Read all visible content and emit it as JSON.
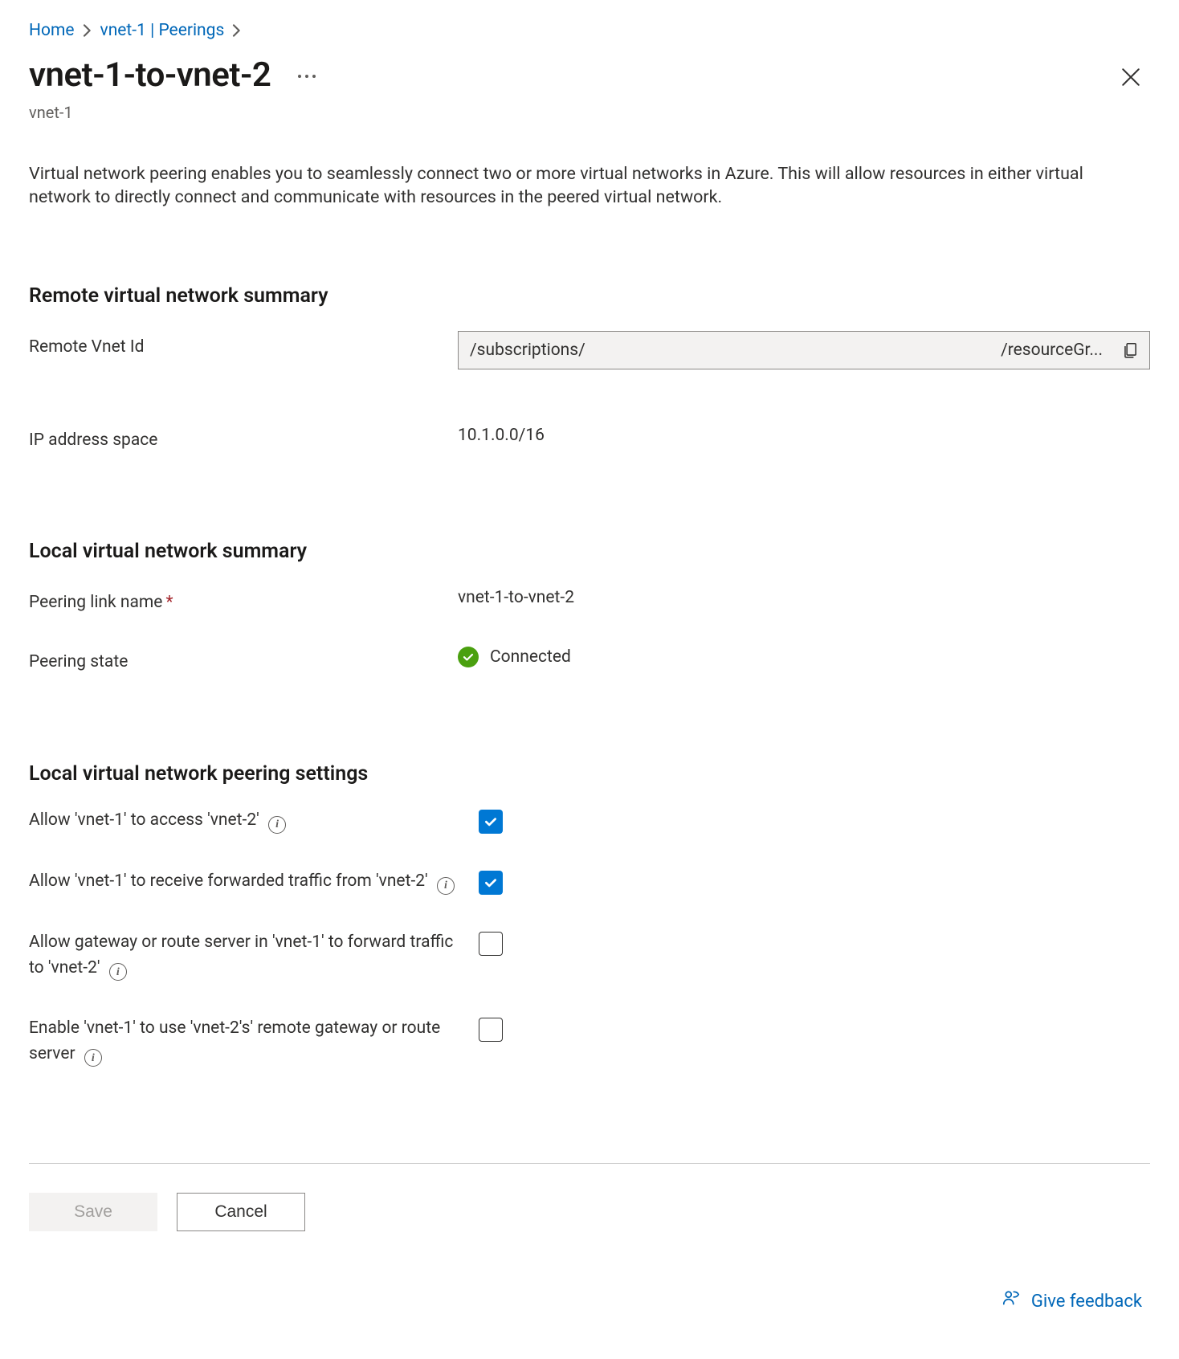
{
  "breadcrumb": {
    "home": "Home",
    "parent": "vnet-1 | Peerings"
  },
  "header": {
    "title": "vnet-1-to-vnet-2",
    "subtitle": "vnet-1"
  },
  "intro": "Virtual network peering enables you to seamlessly connect two or more virtual networks in Azure. This will allow resources in either virtual network to directly connect and communicate with resources in the peered virtual network.",
  "remote": {
    "section_title": "Remote virtual network summary",
    "vnet_id_label": "Remote Vnet Id",
    "vnet_id_prefix": "/subscriptions/",
    "vnet_id_suffix": "/resourceGr...",
    "ip_label": "IP address space",
    "ip_value": "10.1.0.0/16"
  },
  "local": {
    "section_title": "Local virtual network summary",
    "link_name_label": "Peering link name",
    "link_name_value": "vnet-1-to-vnet-2",
    "state_label": "Peering state",
    "state_value": "Connected"
  },
  "settings": {
    "section_title": "Local virtual network peering settings",
    "allow_access_label": "Allow 'vnet-1' to access 'vnet-2'",
    "allow_forwarded_label": "Allow 'vnet-1' to receive forwarded traffic from 'vnet-2'",
    "allow_gateway_label": "Allow gateway or route server in 'vnet-1' to forward traffic to 'vnet-2'",
    "use_remote_gateway_label": "Enable 'vnet-1' to use 'vnet-2's' remote gateway or route server",
    "allow_access_checked": true,
    "allow_forwarded_checked": true,
    "allow_gateway_checked": false,
    "use_remote_gateway_checked": false
  },
  "footer": {
    "save_label": "Save",
    "cancel_label": "Cancel",
    "feedback_label": "Give feedback"
  },
  "colors": {
    "link": "#0067b8",
    "accent": "#0078d4",
    "success": "#4aa00f"
  }
}
